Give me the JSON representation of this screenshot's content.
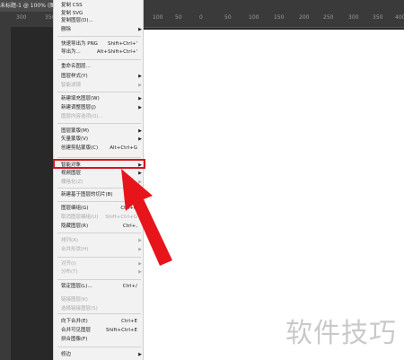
{
  "titlebar": {
    "doc_tab": "未标题-1 @ 100% (图层"
  },
  "ruler": {
    "ticks": [
      "300",
      "350",
      "150",
      "100",
      "50",
      "0",
      "50",
      "100",
      "150",
      "200",
      "250",
      "300",
      "350",
      "400"
    ]
  },
  "menu": {
    "items": [
      {
        "label": "复制 CSS",
        "shortcut": "",
        "arrow": false,
        "disabled": false
      },
      {
        "label": "复制 SVG",
        "shortcut": "",
        "arrow": false,
        "disabled": false
      },
      {
        "label": "复制图层(D)...",
        "shortcut": "",
        "arrow": false,
        "disabled": false
      },
      {
        "label": "删除",
        "shortcut": "",
        "arrow": true,
        "disabled": false
      },
      {
        "label": "快速导出为 PNG",
        "shortcut": "Shift+Ctrl+'",
        "arrow": false,
        "disabled": false
      },
      {
        "label": "导出为...",
        "shortcut": "Alt+Shift+Ctrl+'",
        "arrow": false,
        "disabled": false
      },
      {
        "label": "重命名图层...",
        "shortcut": "",
        "arrow": false,
        "disabled": false
      },
      {
        "label": "图层样式(Y)",
        "shortcut": "",
        "arrow": true,
        "disabled": false
      },
      {
        "label": "智能滤镜",
        "shortcut": "",
        "arrow": true,
        "disabled": true
      },
      {
        "label": "新建填充图层(W)",
        "shortcut": "",
        "arrow": true,
        "disabled": false
      },
      {
        "label": "新建调整图层(J)",
        "shortcut": "",
        "arrow": true,
        "disabled": false
      },
      {
        "label": "图层内容选项(O)...",
        "shortcut": "",
        "arrow": false,
        "disabled": true
      },
      {
        "label": "图层蒙版(M)",
        "shortcut": "",
        "arrow": true,
        "disabled": false
      },
      {
        "label": "矢量蒙版(V)",
        "shortcut": "",
        "arrow": true,
        "disabled": false
      },
      {
        "label": "创建剪贴蒙版(C)",
        "shortcut": "Alt+Ctrl+G",
        "arrow": false,
        "disabled": false
      },
      {
        "label": "智能对象",
        "shortcut": "",
        "arrow": true,
        "disabled": false
      },
      {
        "label": "视频图层",
        "shortcut": "",
        "arrow": true,
        "disabled": false
      },
      {
        "label": "栅格化(Z)",
        "shortcut": "",
        "arrow": true,
        "disabled": true
      },
      {
        "label": "新建基于图层的切片(B)",
        "shortcut": "",
        "arrow": false,
        "disabled": false
      },
      {
        "label": "图层编组(G)",
        "shortcut": "Ctrl+G",
        "arrow": false,
        "disabled": false
      },
      {
        "label": "取消图层编组(U)",
        "shortcut": "Shift+Ctrl+G",
        "arrow": false,
        "disabled": true
      },
      {
        "label": "隐藏图层(R)",
        "shortcut": "Ctrl+,",
        "arrow": false,
        "disabled": false
      },
      {
        "label": "排列(A)",
        "shortcut": "",
        "arrow": true,
        "disabled": true
      },
      {
        "label": "合并形状(H)",
        "shortcut": "",
        "arrow": true,
        "disabled": true
      },
      {
        "label": "对齐(I)",
        "shortcut": "",
        "arrow": true,
        "disabled": true
      },
      {
        "label": "分布(T)",
        "shortcut": "",
        "arrow": true,
        "disabled": true
      },
      {
        "label": "锁定图层(L)...",
        "shortcut": "Ctrl+/",
        "arrow": false,
        "disabled": false
      },
      {
        "label": "链接图层(K)",
        "shortcut": "",
        "arrow": false,
        "disabled": true
      },
      {
        "label": "选择链接图层(S)",
        "shortcut": "",
        "arrow": false,
        "disabled": true
      },
      {
        "label": "向下合并(E)",
        "shortcut": "Ctrl+E",
        "arrow": false,
        "disabled": false
      },
      {
        "label": "合并可见图层",
        "shortcut": "Shift+Ctrl+E",
        "arrow": false,
        "disabled": false
      },
      {
        "label": "拼合图像(F)",
        "shortcut": "",
        "arrow": false,
        "disabled": false
      },
      {
        "label": "修边",
        "shortcut": "",
        "arrow": true,
        "disabled": false
      }
    ]
  },
  "watermark": "软件技巧",
  "colors": {
    "highlight": "#d8141c",
    "arrow": "#e8141c",
    "menu_bg": "#f2f2f2"
  }
}
